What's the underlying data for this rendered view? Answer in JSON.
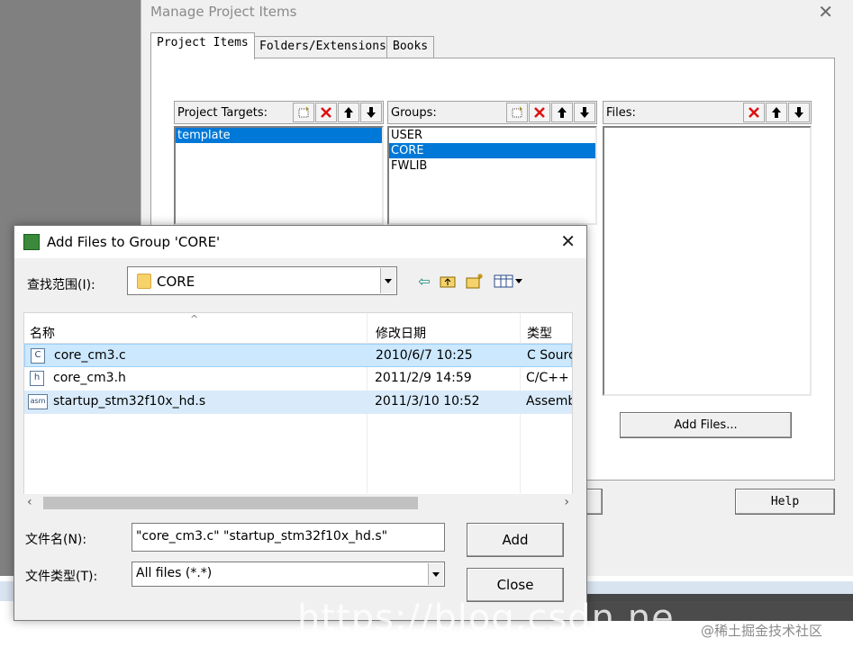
{
  "manage": {
    "title": "Manage Project Items",
    "tabs": [
      "Project Items",
      "Folders/Extensions",
      "Books"
    ],
    "targets": {
      "label": "Project Targets:",
      "items": [
        "template"
      ],
      "selected": 0
    },
    "groups": {
      "label": "Groups:",
      "items": [
        "USER",
        "CORE",
        "FWLIB"
      ],
      "selected": 1
    },
    "files": {
      "label": "Files:",
      "items": []
    },
    "add_files_label": "Add Files...",
    "help_label": "Help"
  },
  "dialog": {
    "title": "Add Files to Group 'CORE'",
    "look_in_label": "查找范围(I):",
    "look_in_value": "CORE",
    "columns": [
      "名称",
      "修改日期",
      "类型"
    ],
    "files": [
      {
        "name": "core_cm3.c",
        "icon": "C",
        "date": "2010/6/7 10:25",
        "type": "C Sourc"
      },
      {
        "name": "core_cm3.h",
        "icon": "h",
        "date": "2011/2/9 14:59",
        "type": "C/C++"
      },
      {
        "name": "startup_stm32f10x_hd.s",
        "icon": "asm",
        "date": "2011/3/10 10:52",
        "type": "Assemb"
      }
    ],
    "filename_label": "文件名(N):",
    "filename_value": "\"core_cm3.c\" \"startup_stm32f10x_hd.s\"",
    "filetype_label": "文件类型(T):",
    "filetype_value": "All files (*.*)",
    "add_label": "Add",
    "close_label": "Close"
  },
  "watermark": "https://blog.csdn.ne",
  "corner_credit": "@稀土掘金技术社区"
}
